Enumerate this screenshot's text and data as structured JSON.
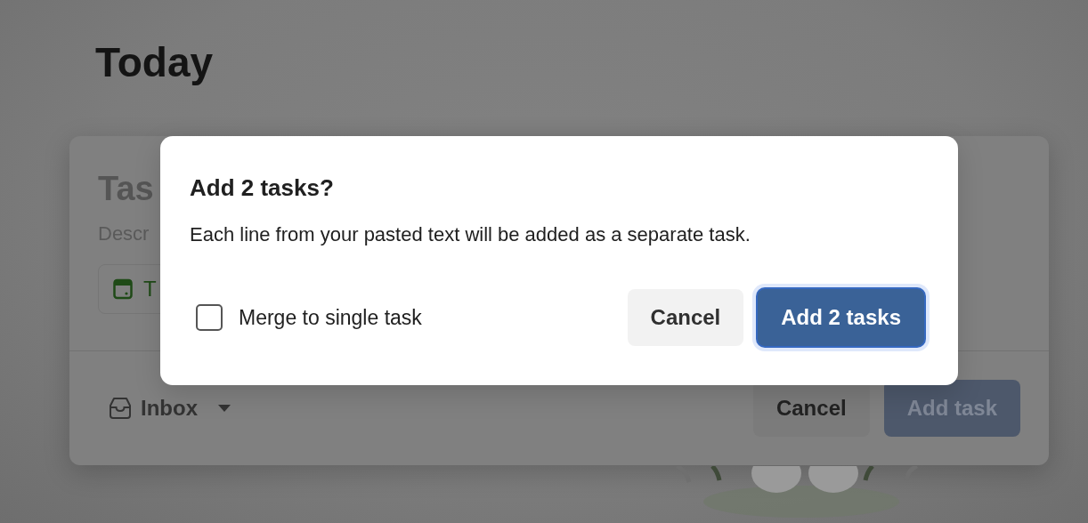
{
  "page_title": "Today",
  "task_editor": {
    "title_placeholder": "Tas",
    "description_placeholder": "Descr",
    "date_chip": "T",
    "project": "Inbox",
    "buttons": [
      {
        "label": "Cancel",
        "kind": "secondary",
        "disabled": false
      },
      {
        "label": "Add task",
        "kind": "primary",
        "disabled": true
      }
    ]
  },
  "dialog": {
    "title": "Add 2 tasks?",
    "message": "Each line from your pasted text will be added as a separate task.",
    "merge": {
      "label": "Merge to single task",
      "checked": false
    },
    "buttons": [
      {
        "label": "Cancel",
        "kind": "secondary",
        "focused": false
      },
      {
        "label": "Add 2 tasks",
        "kind": "primary",
        "focused": true
      }
    ]
  }
}
